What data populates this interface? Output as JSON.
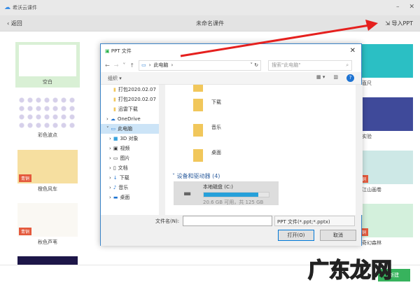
{
  "app": {
    "name": "希沃云课件",
    "minimize": "–",
    "close": "✕"
  },
  "header": {
    "back": "返回",
    "title": "未命名课件",
    "import": "导入PPT"
  },
  "templates_left": [
    {
      "label": "空白"
    },
    {
      "label": "彩色波点"
    },
    {
      "label": "橙色风车",
      "badge": "青铜"
    },
    {
      "label": "秋色芦苇",
      "badge": "青铜"
    }
  ],
  "templates_right": [
    {
      "label": "直尺"
    },
    {
      "label": "实验"
    },
    {
      "label": "江山画卷",
      "badge": "铜"
    },
    {
      "label": "奇幻森林",
      "badge": "铜"
    }
  ],
  "dialog": {
    "title": "PPT 文件",
    "path": "此电脑",
    "search_placeholder": "搜索\"此电脑\"",
    "organize": "组织 ▾",
    "nav": [
      "打包2020.02.07",
      "打包2020.02.07",
      "迅雷下载",
      "OneDrive",
      "此电脑",
      "3D 对象",
      "视频",
      "图片",
      "文档",
      "下载",
      "音乐",
      "桌面"
    ],
    "folders": [
      "下载",
      "音乐",
      "桌面"
    ],
    "drives_header": "设备和驱动器 (4)",
    "drive": {
      "name": "本地磁盘 (C:)",
      "space": "20.6 GB 可用，共 125 GB",
      "used_percent": 84
    },
    "filename_label": "文件名(N):",
    "filename_value": "",
    "filetype": "PPT 文件(*.ppt;*.pptx)",
    "open": "打开(O)",
    "cancel": "取消"
  },
  "footer": {
    "new": "新建"
  },
  "watermark": "广东龙网"
}
